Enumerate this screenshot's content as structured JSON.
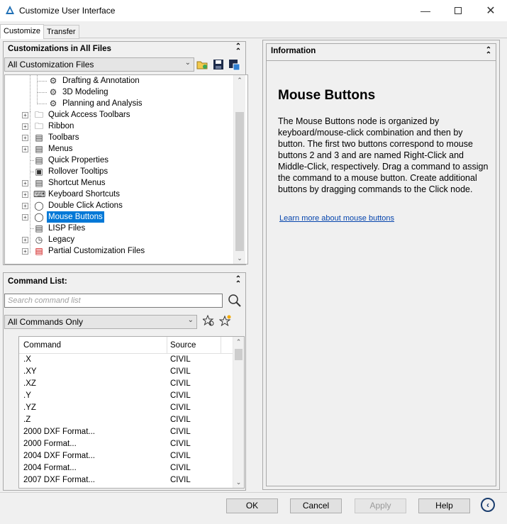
{
  "window": {
    "title": "Customize User Interface",
    "icon": "autocad-icon"
  },
  "tabs": [
    {
      "label": "Customize",
      "active": true
    },
    {
      "label": "Transfer",
      "active": false
    }
  ],
  "customizations": {
    "header": "Customizations in All Files",
    "file_select": "All Customization Files",
    "tree": [
      {
        "label": "Drafting & Annotation",
        "icon": "gear-icon"
      },
      {
        "label": "3D Modeling",
        "icon": "gear-icon"
      },
      {
        "label": "Planning and Analysis",
        "icon": "gear-icon"
      },
      {
        "label": "Quick Access Toolbars",
        "icon": "folder-icon"
      },
      {
        "label": "Ribbon",
        "icon": "folder-icon"
      },
      {
        "label": "Toolbars",
        "icon": "toolbar-icon"
      },
      {
        "label": "Menus",
        "icon": "menu-icon"
      },
      {
        "label": "Quick Properties",
        "icon": "properties-icon"
      },
      {
        "label": "Rollover Tooltips",
        "icon": "tooltip-icon"
      },
      {
        "label": "Shortcut Menus",
        "icon": "shortcut-menu-icon"
      },
      {
        "label": "Keyboard Shortcuts",
        "icon": "keyboard-icon"
      },
      {
        "label": "Double Click Actions",
        "icon": "mouse-icon"
      },
      {
        "label": "Mouse Buttons",
        "icon": "mouse-icon"
      },
      {
        "label": "LISP Files",
        "icon": "lisp-icon"
      },
      {
        "label": "Legacy",
        "icon": "clock-icon"
      },
      {
        "label": "Partial Customization Files",
        "icon": "cui-icon"
      }
    ]
  },
  "command_list": {
    "header": "Command List:",
    "search_placeholder": "Search command list",
    "filter_select": "All Commands Only",
    "columns": [
      "Command",
      "Source"
    ],
    "rows": [
      {
        "command": ".X",
        "source": "CIVIL"
      },
      {
        "command": ".XY",
        "source": "CIVIL"
      },
      {
        "command": ".XZ",
        "source": "CIVIL"
      },
      {
        "command": ".Y",
        "source": "CIVIL"
      },
      {
        "command": ".YZ",
        "source": "CIVIL"
      },
      {
        "command": ".Z",
        "source": "CIVIL"
      },
      {
        "command": "2000 DXF Format...",
        "source": "CIVIL"
      },
      {
        "command": "2000 Format...",
        "source": "CIVIL"
      },
      {
        "command": "2004 DXF Format...",
        "source": "CIVIL"
      },
      {
        "command": "2004 Format...",
        "source": "CIVIL"
      },
      {
        "command": "2007 DXF Format...",
        "source": "CIVIL"
      }
    ]
  },
  "information": {
    "header": "Information",
    "title": "Mouse Buttons",
    "body": "The Mouse Buttons node is organized by keyboard/mouse-click combination and then by button. The first two buttons correspond to mouse buttons 2 and 3 and are named Right-Click and Middle-Click, respectively. Drag a command to assign the command to a mouse button. Create additional buttons by dragging commands to the Click node.",
    "link": "Learn more about mouse buttons"
  },
  "buttons": {
    "ok": "OK",
    "cancel": "Cancel",
    "apply": "Apply",
    "help": "Help"
  }
}
